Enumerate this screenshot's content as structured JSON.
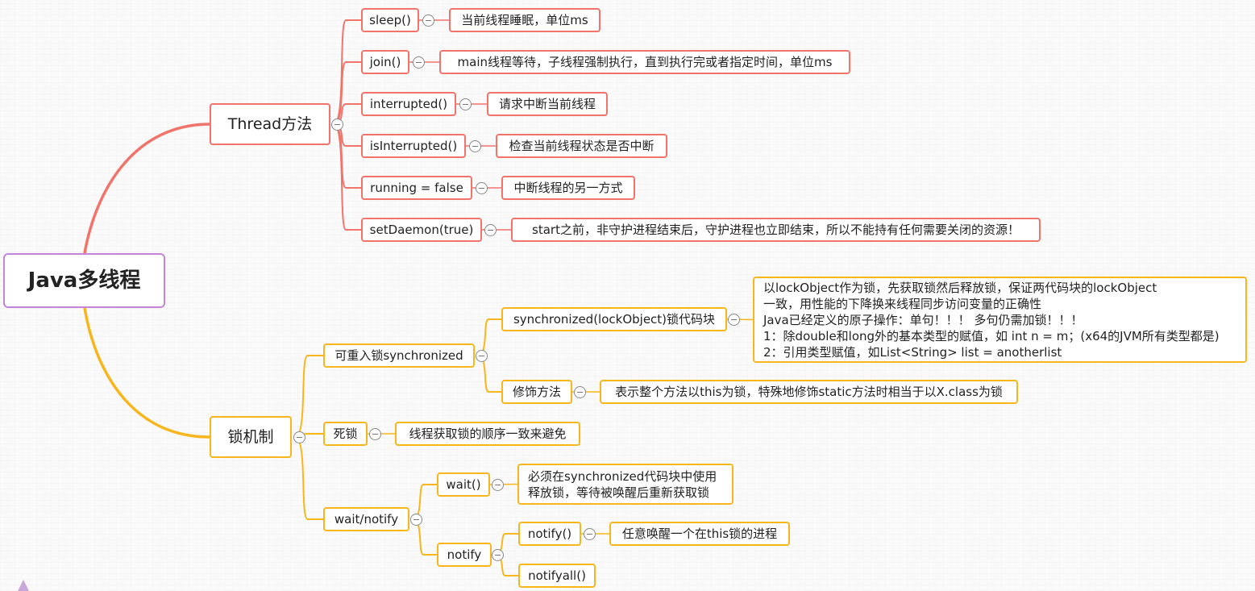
{
  "map": {
    "root": "Java多线程",
    "thread": {
      "title": "Thread方法",
      "methods": [
        {
          "name": "sleep()",
          "desc": "当前线程睡眠，单位ms"
        },
        {
          "name": "join()",
          "desc": "main线程等待，子线程强制执行，直到执行完或者指定时间，单位ms"
        },
        {
          "name": "interrupted()",
          "desc": "请求中断当前线程"
        },
        {
          "name": "isInterrupted()",
          "desc": "检查当前线程状态是否中断"
        },
        {
          "name": "running = false",
          "desc": "中断线程的另一方式"
        },
        {
          "name": "setDaemon(true)",
          "desc": "start之前，非守护进程结束后，守护进程也立即结束，所以不能持有任何需要关闭的资源！"
        }
      ]
    },
    "lock": {
      "title": "锁机制",
      "reentrant": {
        "title": "可重入锁synchronized",
        "block": {
          "title": "synchronized(lockObject)锁代码块",
          "note": "以lockObject作为锁，先获取锁然后释放锁，保证两代码块的lockObject\n一致，用性能的下降换来线程同步访问变量的正确性\nJava已经定义的原子操作：单句！！！ 多句仍需加锁！！！\n1：除double和long外的基本类型的赋值，如 int n = m；(x64的JVM所有类型都是)\n2：引用类型赋值，如List<String> list = anotherlist"
        },
        "method": {
          "title": "修饰方法",
          "note": "表示整个方法以this为锁，特殊地修饰static方法时相当于以X.class为锁"
        }
      },
      "deadlock": {
        "title": "死锁",
        "note": "线程获取锁的顺序一致来避免"
      },
      "waitnotify": {
        "title": "wait/notify",
        "wait": {
          "title": "wait()",
          "note": "必须在synchronized代码块中使用\n释放锁，等待被唤醒后重新获取锁"
        },
        "notify": {
          "title": "notify",
          "one": {
            "title": "notify()",
            "note": "任意唤醒一个在this锁的进程"
          },
          "all": {
            "title": "notifyall()"
          }
        }
      }
    }
  },
  "colors": {
    "root_border": "#c684d8",
    "thread_branch": "#f2736a",
    "lock_branch": "#f8b61c"
  }
}
